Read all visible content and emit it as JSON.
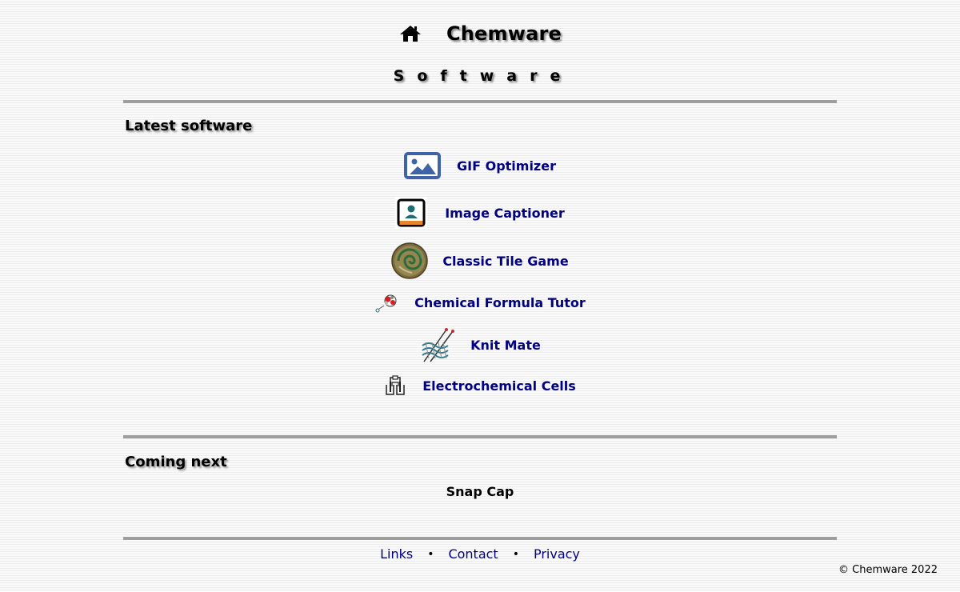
{
  "header": {
    "title": "Chemware",
    "home_icon": "home-icon"
  },
  "subtitle": "Software",
  "latest": {
    "heading": "Latest software",
    "items": [
      {
        "label": "GIF Optimizer",
        "icon": "image-picture-icon"
      },
      {
        "label": "Image Captioner",
        "icon": "portrait-frame-icon"
      },
      {
        "label": "Classic Tile Game",
        "icon": "tile-medallion-icon"
      },
      {
        "label": "Chemical Formula Tutor",
        "icon": "molecule-icon"
      },
      {
        "label": "Knit Mate",
        "icon": "knitting-needles-icon"
      },
      {
        "label": "Electrochemical Cells",
        "icon": "electrochemical-cell-icon"
      }
    ]
  },
  "coming_next": {
    "heading": "Coming next",
    "items": [
      "Snap Cap"
    ]
  },
  "footer": {
    "links": [
      "Links",
      "Contact",
      "Privacy"
    ],
    "separator": "•",
    "copyright": "© Chemware 2022"
  },
  "colors": {
    "link": "#000080",
    "rule": "#9e9e9e",
    "image_icon_blue": "#3e63a8",
    "portrait_teal": "#1f6a73",
    "portrait_orange": "#e8852a"
  }
}
